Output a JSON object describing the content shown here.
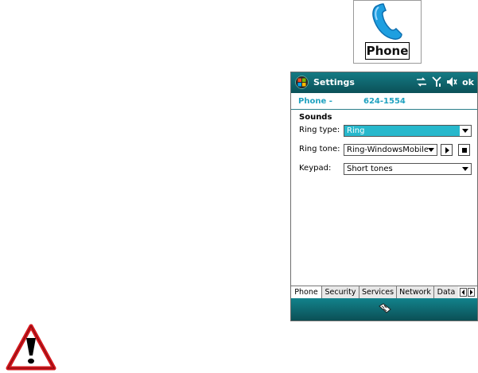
{
  "app_icon": {
    "label": "Phone",
    "icon": "phone-handset-icon"
  },
  "window": {
    "title": "Settings",
    "ok_label": "ok",
    "status_icons": [
      "connectivity-icon",
      "signal-antenna-icon",
      "speaker-muted-icon"
    ]
  },
  "header": {
    "title": "Phone -",
    "number": "624-1554"
  },
  "sounds": {
    "heading": "Sounds",
    "ring_type": {
      "label": "Ring type:",
      "value": "Ring"
    },
    "ring_tone": {
      "label": "Ring tone:",
      "value": "Ring-WindowsMobile"
    },
    "keypad": {
      "label": "Keypad:",
      "value": "Short tones"
    }
  },
  "tabs": [
    {
      "label": "Phone",
      "active": true
    },
    {
      "label": "Security",
      "active": false
    },
    {
      "label": "Services",
      "active": false
    },
    {
      "label": "Network",
      "active": false
    },
    {
      "label": "Data",
      "active": false
    }
  ],
  "colors": {
    "titlebar": "#0f6870",
    "header_text": "#1fa2c0",
    "selection": "#27b8cc",
    "caution": "#d4181e"
  }
}
